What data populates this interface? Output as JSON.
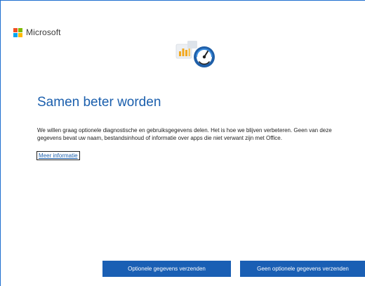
{
  "brand": {
    "name": "Microsoft",
    "logo_colors": [
      "#f25022",
      "#7fba00",
      "#00a4ef",
      "#ffb900"
    ]
  },
  "hero": {
    "icon": "diagnostics-gauge-icon"
  },
  "main": {
    "title": "Samen beter worden",
    "description": "We willen graag optionele diagnostische en gebruiksgegevens delen. Het is hoe we blijven verbeteren. Geen van deze gegevens bevat uw naam, bestandsinhoud of informatie over apps die niet verwant zijn met Office.",
    "more_link": "Meer informatie"
  },
  "actions": {
    "send_optional": "Optionele gegevens verzenden",
    "no_optional": "Geen optionele gegevens verzenden"
  },
  "colors": {
    "accent": "#1a5fb4",
    "title": "#1b5fad"
  }
}
